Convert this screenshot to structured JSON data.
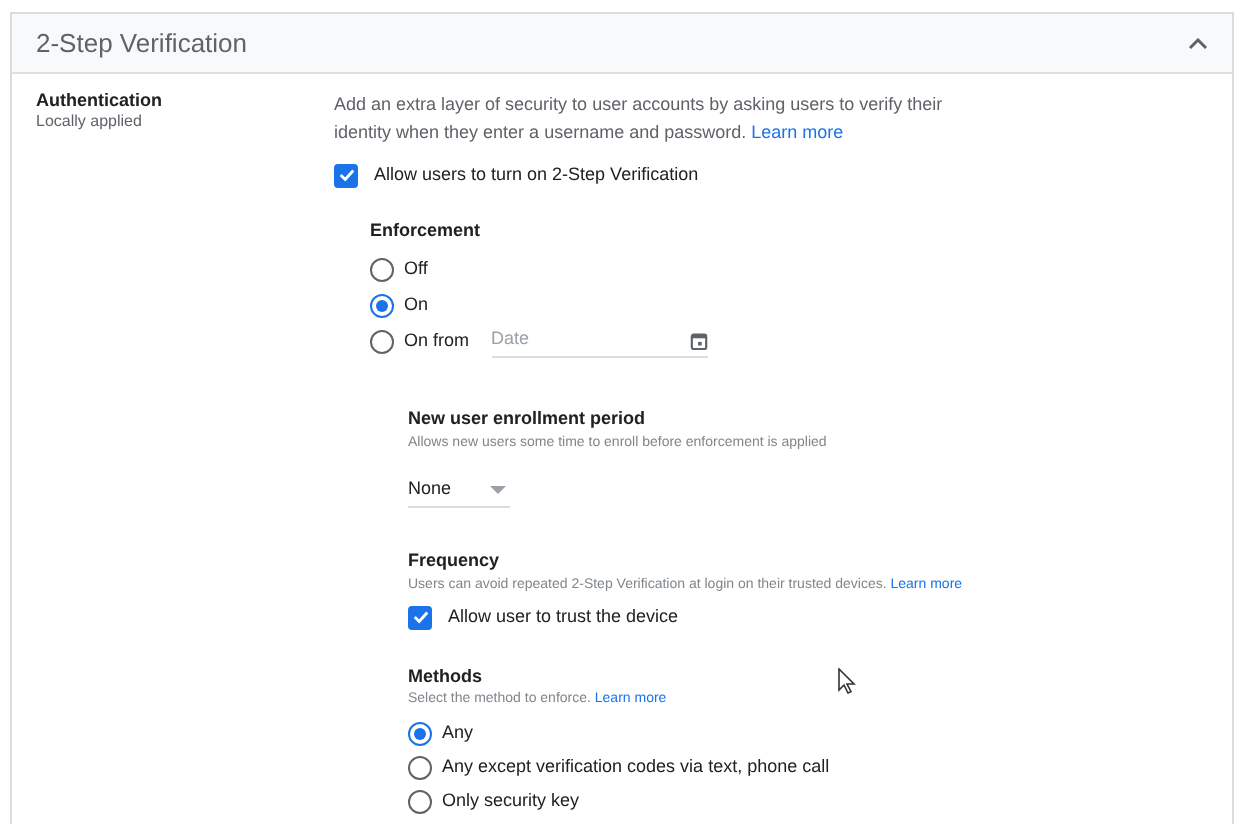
{
  "panel": {
    "title": "2-Step Verification",
    "expanded": true
  },
  "setting": {
    "label": "Authentication",
    "sublabel": "Locally applied"
  },
  "description": {
    "text": "Add an extra layer of security to user accounts by asking users to verify their identity when they enter a username and password.",
    "link": "Learn more"
  },
  "allow_checkbox": {
    "label": "Allow users to turn on 2-Step Verification",
    "checked": true
  },
  "enforcement": {
    "title": "Enforcement",
    "options": [
      {
        "label": "Off",
        "selected": false
      },
      {
        "label": "On",
        "selected": true
      },
      {
        "label": "On from",
        "selected": false,
        "kind": "date"
      }
    ],
    "date_field": {
      "placeholder": "Date"
    }
  },
  "enrollment": {
    "title": "New user enrollment period",
    "description": "Allows new users some time to enroll before enforcement is applied",
    "dropdown": {
      "value": "None"
    }
  },
  "frequency": {
    "title": "Frequency",
    "description": "Users can avoid repeated 2-Step Verification at login on their trusted devices.",
    "link": "Learn more",
    "checkbox": {
      "label": "Allow user to trust the device",
      "checked": true
    }
  },
  "methods": {
    "title": "Methods",
    "description": "Select the method to enforce.",
    "link": "Learn more",
    "options": [
      {
        "label": "Any",
        "selected": true
      },
      {
        "label": "Any except verification codes via text, phone call",
        "selected": false
      },
      {
        "label": "Only security key",
        "selected": false
      }
    ]
  }
}
